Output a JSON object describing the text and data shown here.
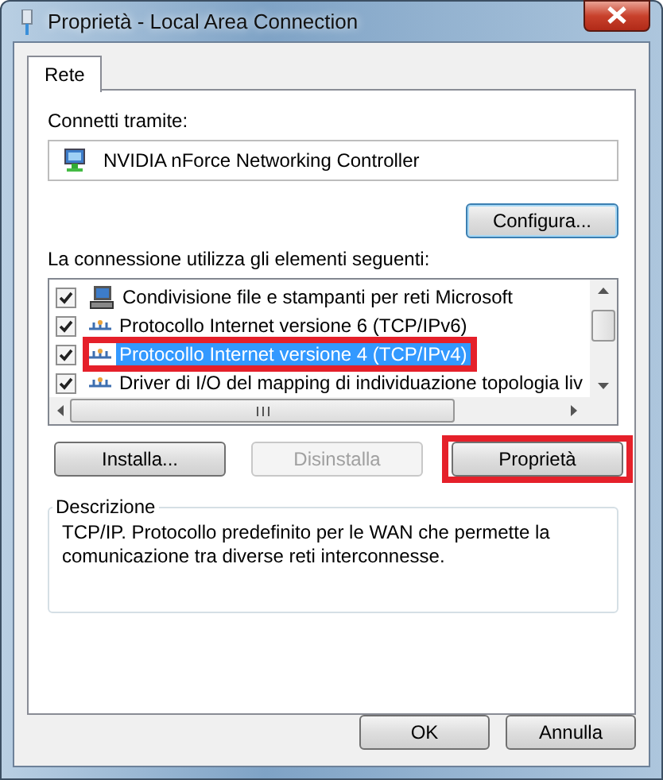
{
  "window": {
    "title": "Proprietà - Local Area Connection"
  },
  "tabs": [
    {
      "label": "Rete",
      "selected": true
    }
  ],
  "connect_via": {
    "label": "Connetti tramite:",
    "adapter": "NVIDIA nForce Networking Controller",
    "button": "Configura..."
  },
  "components": {
    "label": "La connessione utilizza gli elementi seguenti:",
    "items": [
      {
        "name": "Condivisione file e stampanti per reti Microsoft",
        "kind": "service",
        "checked": true,
        "selected": false,
        "highlighted": false
      },
      {
        "name": "Protocollo Internet versione 6 (TCP/IPv6)",
        "kind": "protocol",
        "checked": true,
        "selected": false,
        "highlighted": false
      },
      {
        "name": "Protocollo Internet versione 4 (TCP/IPv4)",
        "kind": "protocol",
        "checked": true,
        "selected": true,
        "highlighted": true
      },
      {
        "name": "Driver di I/O del mapping di individuazione topologia liv",
        "kind": "protocol",
        "checked": true,
        "selected": false,
        "highlighted": false
      }
    ]
  },
  "item_buttons": [
    {
      "label": "Installa...",
      "disabled": false,
      "highlighted": false
    },
    {
      "label": "Disinstalla",
      "disabled": true,
      "highlighted": false
    },
    {
      "label": "Proprietà",
      "disabled": false,
      "highlighted": true
    }
  ],
  "description": {
    "title": "Descrizione",
    "text": "TCP/IP. Protocollo predefinito per le WAN che permette la comunicazione tra diverse reti interconnesse."
  },
  "buttons": [
    {
      "label": "OK"
    },
    {
      "label": "Annulla"
    }
  ]
}
